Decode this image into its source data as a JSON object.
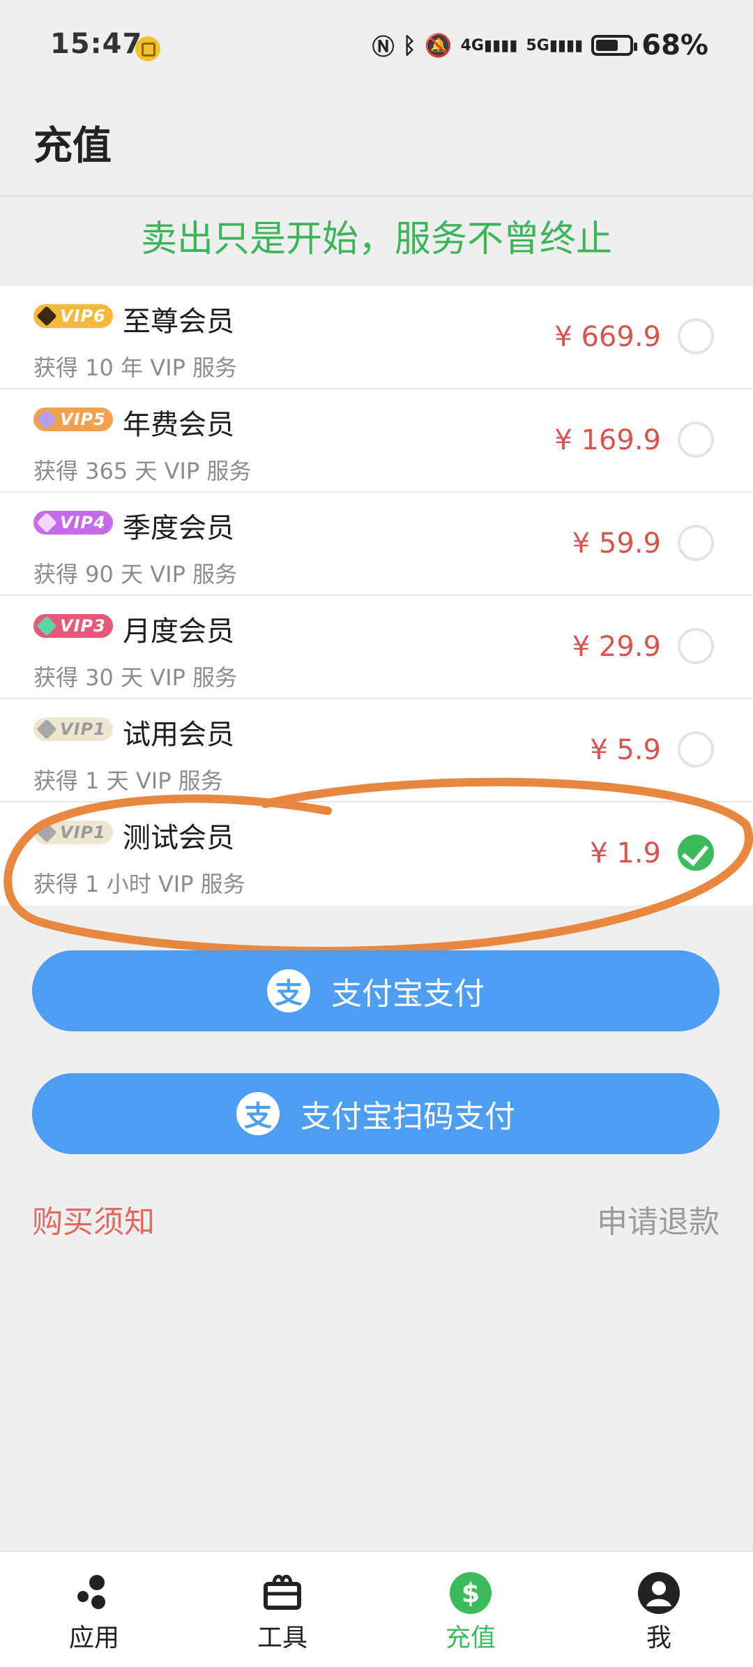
{
  "status_bar": {
    "time": "15:47",
    "icons": [
      "nfc-icon",
      "bluetooth-icon",
      "mute-icon",
      "signal-4g-icon",
      "signal-5g-icon",
      "battery-icon"
    ],
    "battery_label": "68%",
    "battery_level": 0.68,
    "net1": "4G",
    "net2": "5G"
  },
  "header": {
    "title": "充值"
  },
  "slogan": "卖出只是开始，服务不曾终止",
  "plans": [
    {
      "badge": "VIP6",
      "badge_color": "#f4b93a",
      "gem_color": "#3a2a10",
      "name": "至尊会员",
      "desc": "获得 10 年 VIP 服务",
      "price": "¥ 669.9",
      "selected": false
    },
    {
      "badge": "VIP5",
      "badge_color": "#f0a04e",
      "gem_color": "#b89de8",
      "name": "年费会员",
      "desc": "获得 365 天 VIP 服务",
      "price": "¥ 169.9",
      "selected": false
    },
    {
      "badge": "VIP4",
      "badge_color": "#c56bea",
      "gem_color": "#f3d6ff",
      "name": "季度会员",
      "desc": "获得 90 天 VIP 服务",
      "price": "¥ 59.9",
      "selected": false
    },
    {
      "badge": "VIP3",
      "badge_color": "#e8567a",
      "gem_color": "#5fd3a8",
      "name": "月度会员",
      "desc": "获得 30 天 VIP 服务",
      "price": "¥ 29.9",
      "selected": false
    },
    {
      "badge": "VIP1",
      "badge_color": "#efe6d2",
      "gem_color": "#a8a8a8",
      "name": "试用会员",
      "desc": "获得 1 天 VIP 服务",
      "price": "¥ 5.9",
      "selected": false
    },
    {
      "badge": "VIP1",
      "badge_color": "#efe6d2",
      "gem_color": "#a8a8a8",
      "name": "测试会员",
      "desc": "获得 1 小时 VIP 服务",
      "price": "¥ 1.9",
      "selected": true
    }
  ],
  "buttons": {
    "alipay": "支付宝支付",
    "alipay_qr": "支付宝扫码支付",
    "alipay_glyph": "支"
  },
  "links": {
    "purchase_notice": "购买须知",
    "refund": "申请退款"
  },
  "nav": [
    {
      "label": "应用",
      "icon": "apps-icon",
      "active": false
    },
    {
      "label": "工具",
      "icon": "toolbox-icon",
      "active": false
    },
    {
      "label": "充值",
      "icon": "dollar-icon",
      "active": true
    },
    {
      "label": "我",
      "icon": "profile-icon",
      "active": false
    }
  ],
  "colors": {
    "accent_green": "#3cba5c",
    "price_red": "#d9534f",
    "button_blue": "#4d9df2",
    "annotation_orange": "#e8873f"
  }
}
